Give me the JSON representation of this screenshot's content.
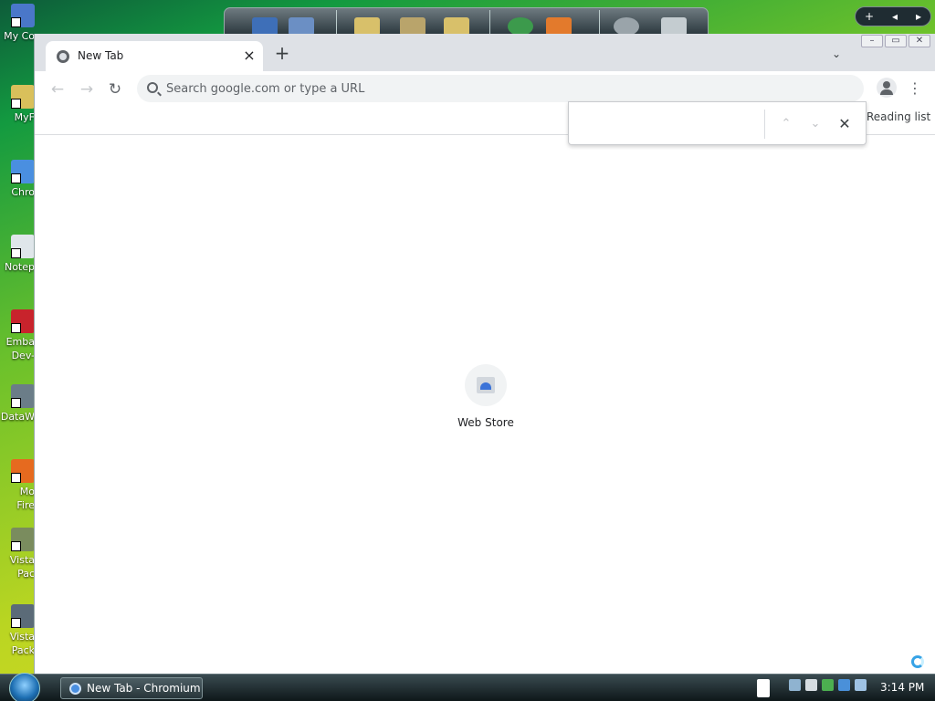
{
  "desktop": {
    "icons": [
      {
        "label": "My Co",
        "icon": "computer-icon",
        "color": "#4a77c9"
      },
      {
        "label": "MyF",
        "icon": "folder-shortcut-icon",
        "color": "#d9c05b"
      },
      {
        "label": "Chro",
        "icon": "chromium-icon",
        "color": "#4a8fe0"
      },
      {
        "label": "Notep",
        "icon": "notepad-icon",
        "color": "#dfe6ea"
      },
      {
        "label": "Emba",
        "label2": "Dev-",
        "icon": "embarcadero-icon",
        "color": "#c8232c"
      },
      {
        "label": "DataW",
        "icon": "datawindow-icon",
        "color": "#6b7d88"
      },
      {
        "label": "Mo",
        "label2": "Fire",
        "icon": "firefox-icon",
        "color": "#e66a1f"
      },
      {
        "label": "Vista",
        "label2": "Pac",
        "icon": "vista-pack-icon",
        "color": "#7a8c5e"
      },
      {
        "label": "Vista",
        "label2": "Pack",
        "icon": "vista-pack-icon",
        "color": "#5b6b78"
      }
    ]
  },
  "browser": {
    "tab": {
      "title": "New Tab",
      "icon": "globe-icon"
    },
    "new_tab_symbol": "+",
    "tab_search_symbol": "⌄",
    "omnibox": {
      "placeholder": "Search google.com or type a URL"
    },
    "reading_list": "Reading list",
    "find_bar": {
      "value": "",
      "prev": "⌃",
      "next": "⌄",
      "close": "✕"
    },
    "shortcut": {
      "label": "Web Store",
      "icon": "web-store-icon"
    }
  },
  "taskbar": {
    "window_button": "New Tab - Chromium",
    "clock": "3:14 PM"
  },
  "sidebar_control": {
    "add": "+",
    "prev": "◂",
    "next": "▸"
  }
}
